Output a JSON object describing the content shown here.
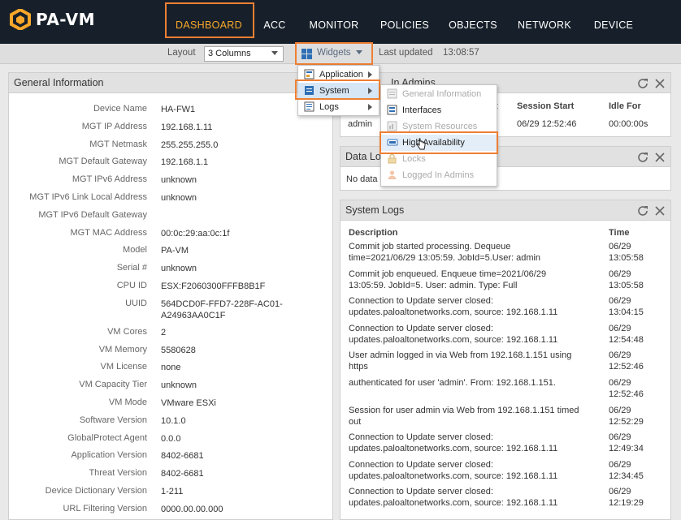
{
  "app": {
    "logo_text": "PA-VM"
  },
  "nav": {
    "tabs": [
      {
        "label": "DASHBOARD",
        "active": true
      },
      {
        "label": "ACC"
      },
      {
        "label": "MONITOR"
      },
      {
        "label": "POLICIES"
      },
      {
        "label": "OBJECTS"
      },
      {
        "label": "NETWORK"
      },
      {
        "label": "DEVICE"
      }
    ]
  },
  "toolbar": {
    "layout_label": "Layout",
    "layout_value": "3 Columns",
    "widgets_label": "Widgets",
    "last_updated_label": "Last updated",
    "last_updated_value": "13:08:57"
  },
  "general_info": {
    "title": "General Information",
    "rows": [
      {
        "label": "Device Name",
        "value": "HA-FW1"
      },
      {
        "label": "MGT IP Address",
        "value": "192.168.1.11"
      },
      {
        "label": "MGT Netmask",
        "value": "255.255.255.0"
      },
      {
        "label": "MGT Default Gateway",
        "value": "192.168.1.1"
      },
      {
        "label": "MGT IPv6 Address",
        "value": "unknown"
      },
      {
        "label": "MGT IPv6 Link Local Address",
        "value": "unknown"
      },
      {
        "label": "MGT IPv6 Default Gateway",
        "value": ""
      },
      {
        "label": "MGT MAC Address",
        "value": "00:0c:29:aa:0c:1f"
      },
      {
        "label": "Model",
        "value": "PA-VM"
      },
      {
        "label": "Serial #",
        "value": "unknown"
      },
      {
        "label": "CPU ID",
        "value": "ESX:F2060300FFFB8B1F"
      },
      {
        "label": "UUID",
        "value": "564DCD0F-FFD7-228F-AC01-A24963AA0C1F"
      },
      {
        "label": "VM Cores",
        "value": "2"
      },
      {
        "label": "VM Memory",
        "value": "5580628"
      },
      {
        "label": "VM License",
        "value": "none"
      },
      {
        "label": "VM Capacity Tier",
        "value": "unknown"
      },
      {
        "label": "VM Mode",
        "value": "VMware ESXi"
      },
      {
        "label": "Software Version",
        "value": "10.1.0"
      },
      {
        "label": "GlobalProtect Agent",
        "value": "0.0.0"
      },
      {
        "label": "Application Version",
        "value": "8402-6681"
      },
      {
        "label": "Threat Version",
        "value": "8402-6681"
      },
      {
        "label": "Device Dictionary Version",
        "value": "1-211"
      },
      {
        "label": "URL Filtering Version",
        "value": "0000.00.00.000"
      }
    ]
  },
  "logged_in_admins": {
    "title_visible": "In Admins",
    "col_from_visible": "t",
    "col_session_start": "Session Start",
    "col_idle_for": "Idle For",
    "row": {
      "admin": "admin",
      "session_start": "06/29 12:52:46",
      "idle_for": "00:00:00s"
    }
  },
  "data_logs": {
    "title_visible": "Data Lo",
    "body_visible": "No data a"
  },
  "system_logs": {
    "title": "System Logs",
    "col_description": "Description",
    "col_time": "Time",
    "rows": [
      {
        "desc1": "Commit job started processing. Dequeue",
        "desc2": "time=2021/06/29 13:05:59. JobId=5.User: admin",
        "t1": "06/29",
        "t2": "13:05:58"
      },
      {
        "desc1": "Commit job enqueued. Enqueue time=2021/06/29",
        "desc2": "13:05:59. JobId=5. User: admin. Type: Full",
        "t1": "06/29",
        "t2": "13:05:58"
      },
      {
        "desc1": "Connection to Update server closed:",
        "desc2": "updates.paloaltonetworks.com, source: 192.168.1.11",
        "t1": "06/29",
        "t2": "13:04:15"
      },
      {
        "desc1": "Connection to Update server closed:",
        "desc2": "updates.paloaltonetworks.com, source: 192.168.1.11",
        "t1": "06/29",
        "t2": "12:54:48"
      },
      {
        "desc1": "User admin logged in via Web from 192.168.1.151 using",
        "desc2": "https",
        "t1": "06/29",
        "t2": "12:52:46"
      },
      {
        "desc1": "authenticated for user 'admin'. From: 192.168.1.151.",
        "desc2": "",
        "t1": "06/29",
        "t2": "12:52:46"
      },
      {
        "desc1": "Session for user admin via Web from 192.168.1.151 timed",
        "desc2": "out",
        "t1": "06/29",
        "t2": "12:52:29"
      },
      {
        "desc1": "Connection to Update server closed:",
        "desc2": "updates.paloaltonetworks.com, source: 192.168.1.11",
        "t1": "06/29",
        "t2": "12:49:34"
      },
      {
        "desc1": "Connection to Update server closed:",
        "desc2": "updates.paloaltonetworks.com, source: 192.168.1.11",
        "t1": "06/29",
        "t2": "12:34:45"
      },
      {
        "desc1": "Connection to Update server closed:",
        "desc2": "updates.paloaltonetworks.com, source: 192.168.1.11",
        "t1": "06/29",
        "t2": "12:19:29"
      }
    ]
  },
  "widgets_menu": {
    "items": [
      {
        "label": "Application",
        "icon": "application-icon"
      },
      {
        "label": "System",
        "icon": "system-icon"
      },
      {
        "label": "Logs",
        "icon": "logs-icon"
      }
    ]
  },
  "system_submenu": {
    "items": [
      {
        "label": "General Information",
        "disabled": true
      },
      {
        "label": "Interfaces",
        "disabled": false
      },
      {
        "label": "System Resources",
        "disabled": true
      },
      {
        "label": "High Availability",
        "disabled": false
      },
      {
        "label": "Locks",
        "disabled": true
      },
      {
        "label": "Logged In Admins",
        "disabled": true
      }
    ]
  },
  "colors": {
    "nav_bg": "#17202a",
    "active_tab": "#f9a72a",
    "highlight_box": "#ee7f33",
    "menu_selected": "#d7e6f5"
  }
}
